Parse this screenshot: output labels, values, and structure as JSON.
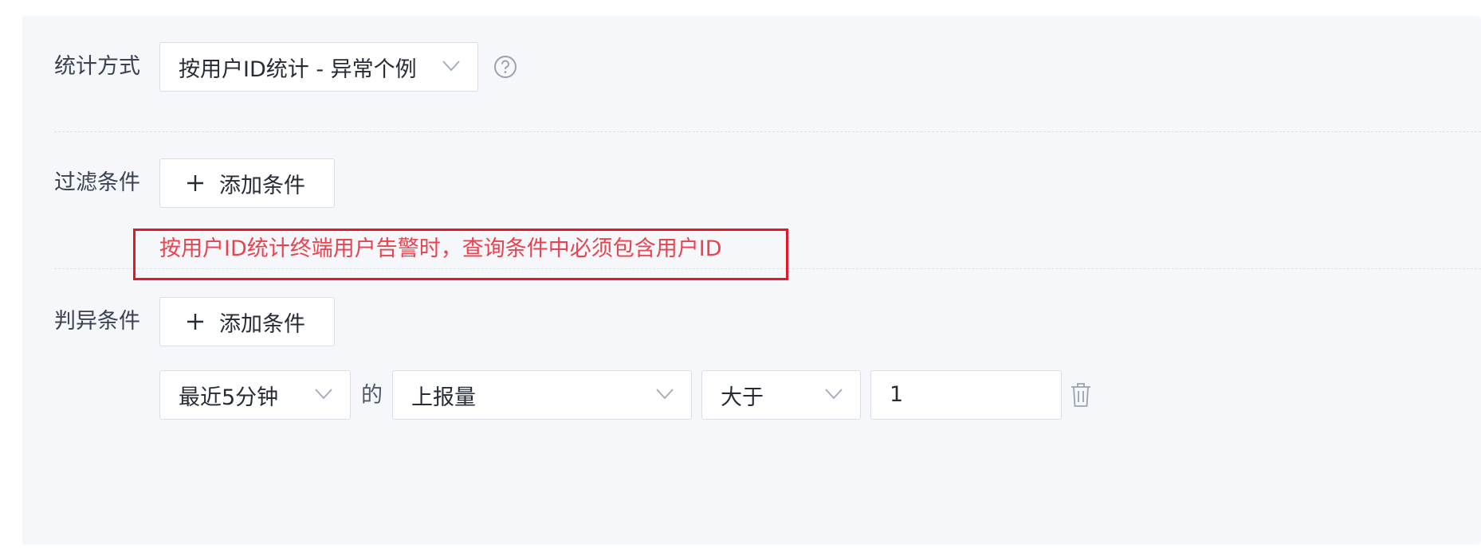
{
  "stat_method": {
    "label": "统计方式",
    "selected": "按用户ID统计 - 异常个例"
  },
  "filter": {
    "label": "过滤条件",
    "add_button": "添加条件",
    "error_message": "按用户ID统计终端用户告警时，查询条件中必须包含用户ID"
  },
  "anomaly": {
    "label": "判异条件",
    "add_button": "添加条件",
    "rule": {
      "time_window": "最近5分钟",
      "of_text": "的",
      "metric": "上报量",
      "operator": "大于",
      "value": "1"
    }
  },
  "colors": {
    "error": "#e8434e",
    "error_border": "#e3192a",
    "panel_bg": "#f5f7fb"
  }
}
